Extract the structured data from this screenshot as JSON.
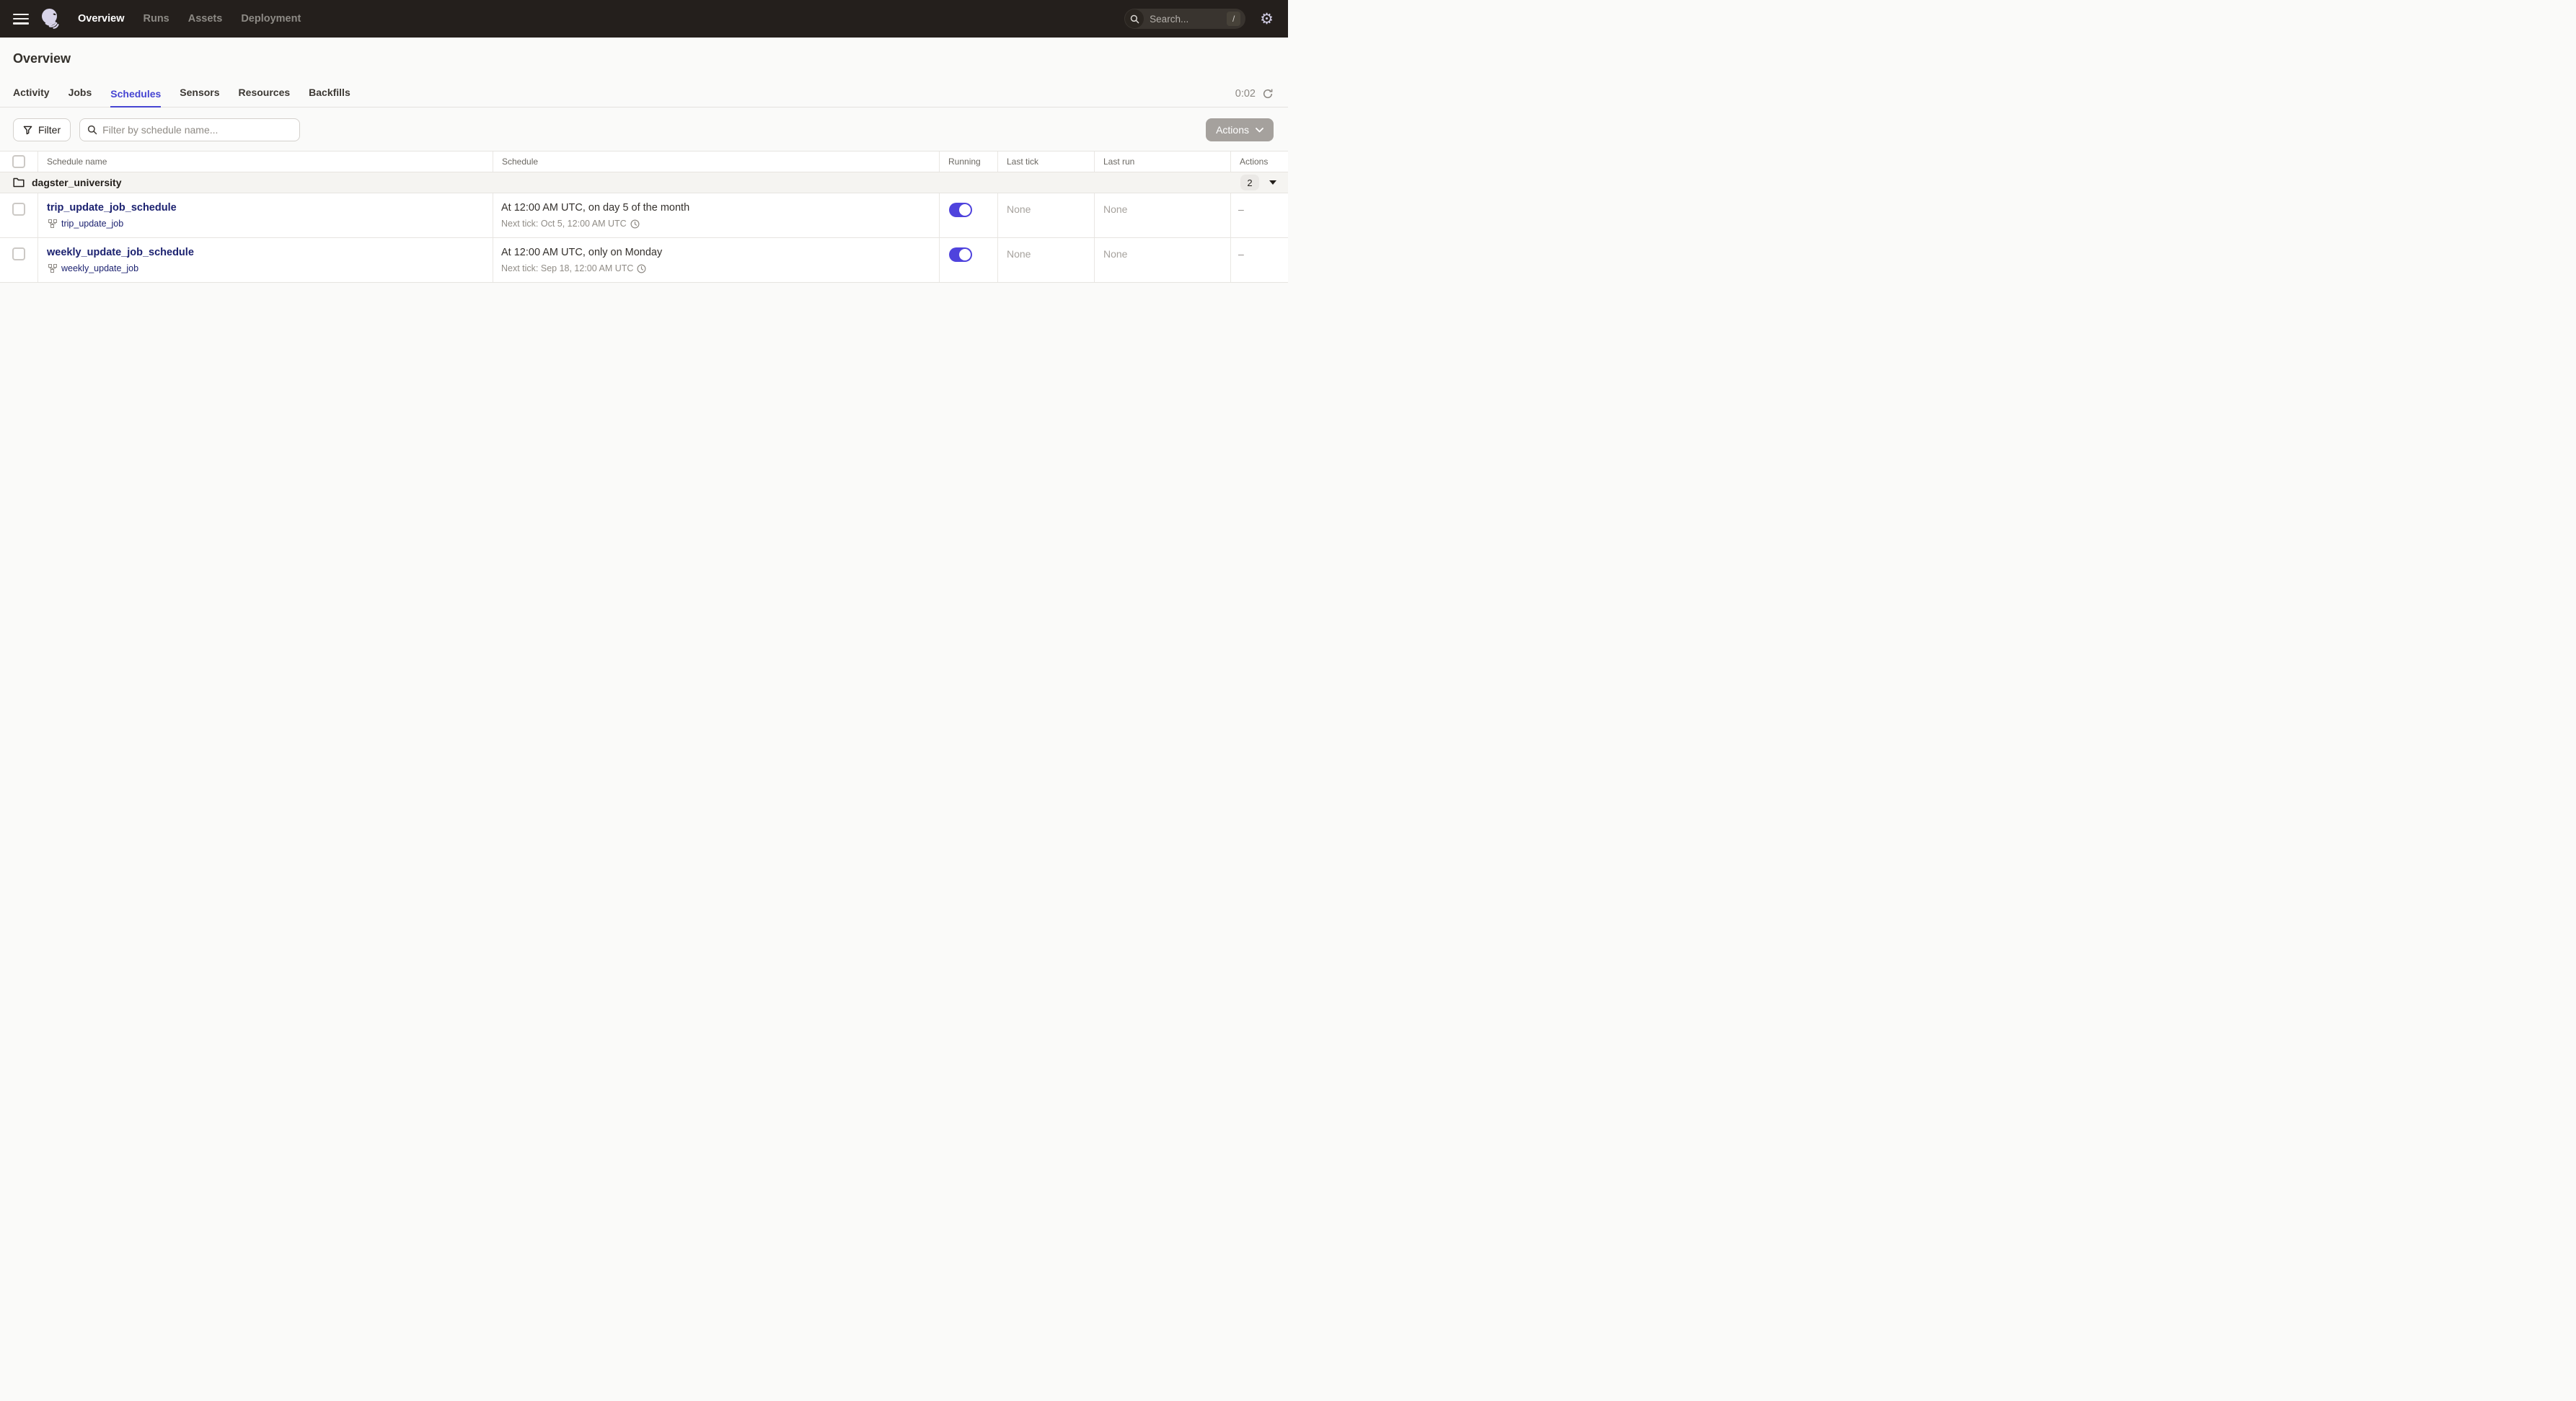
{
  "nav": {
    "items": [
      {
        "label": "Overview",
        "active": true
      },
      {
        "label": "Runs",
        "active": false
      },
      {
        "label": "Assets",
        "active": false
      },
      {
        "label": "Deployment",
        "active": false
      }
    ],
    "search": {
      "placeholder": "Search...",
      "shortcut": "/"
    }
  },
  "header": {
    "title": "Overview"
  },
  "tabs": [
    {
      "label": "Activity",
      "active": false
    },
    {
      "label": "Jobs",
      "active": false
    },
    {
      "label": "Schedules",
      "active": true
    },
    {
      "label": "Sensors",
      "active": false
    },
    {
      "label": "Resources",
      "active": false
    },
    {
      "label": "Backfills",
      "active": false
    }
  ],
  "refresh": {
    "timer": "0:02"
  },
  "toolbar": {
    "filter_label": "Filter",
    "filter_placeholder": "Filter by schedule name...",
    "actions_label": "Actions"
  },
  "table": {
    "columns": [
      "Schedule name",
      "Schedule",
      "Running",
      "Last tick",
      "Last run",
      "Actions"
    ],
    "group": {
      "name": "dagster_university",
      "count": "2"
    },
    "rows": [
      {
        "name": "trip_update_job_schedule",
        "job": "trip_update_job",
        "schedule": "At 12:00 AM UTC, on day 5 of the month",
        "next_tick": "Next tick: Oct 5, 12:00 AM UTC",
        "running": true,
        "last_tick": "None",
        "last_run": "None",
        "actions": "–"
      },
      {
        "name": "weekly_update_job_schedule",
        "job": "weekly_update_job",
        "schedule": "At 12:00 AM UTC, only on Monday",
        "next_tick": "Next tick: Sep 18, 12:00 AM UTC",
        "running": true,
        "last_tick": "None",
        "last_run": "None",
        "actions": "–"
      }
    ]
  },
  "colors": {
    "accent": "#4645d2",
    "link": "#1c2270",
    "toggle_on": "#4f43dd",
    "nav_bg": "#241f1c",
    "page_bg": "#fafaf9"
  }
}
